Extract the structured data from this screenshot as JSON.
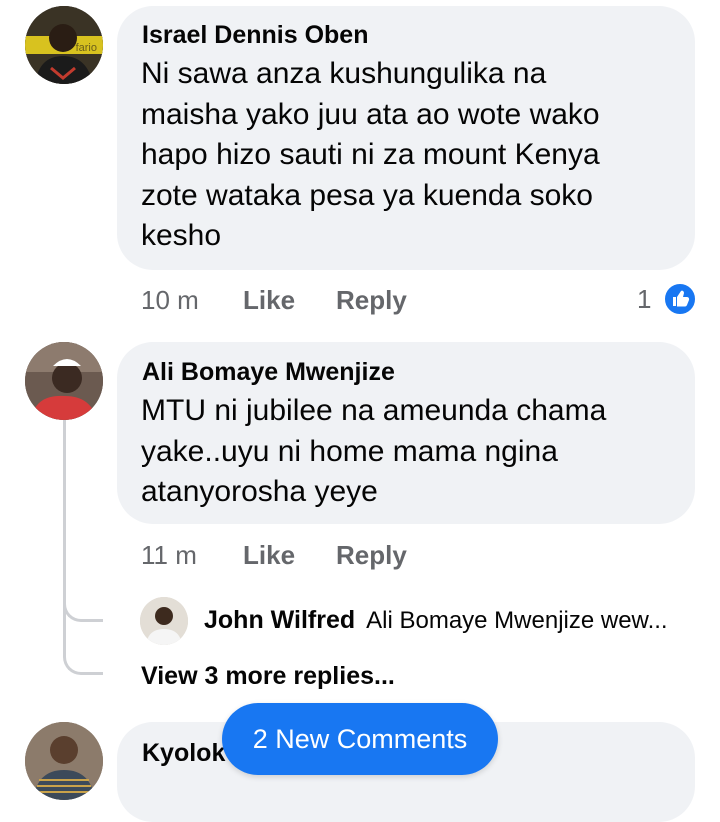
{
  "comments": [
    {
      "author": "Israel Dennis Oben",
      "text_lines": [
        "Ni sawa anza kushungulika na",
        "maisha yako juu ata ao wote wako",
        "hapo hizo sauti ni za mount Kenya",
        "zote wataka pesa ya kuenda soko",
        "kesho"
      ],
      "time": "10 m",
      "like_label": "Like",
      "reply_label": "Reply",
      "reaction_count": "1",
      "avatar_badge": "fario"
    },
    {
      "author": "Ali Bomaye Mwenjize",
      "text_lines": [
        "MTU ni jubilee na ameunda chama",
        "yake..uyu ni home mama ngina",
        "atanyorosha yeye"
      ],
      "time": "11 m",
      "like_label": "Like",
      "reply_label": "Reply",
      "reply_preview": {
        "author": "John Wilfred",
        "text": "Ali Bomaye Mwenjize wew..."
      },
      "view_more": "View 3 more replies..."
    },
    {
      "author": "Kyolok"
    }
  ],
  "new_comments_label": "2 New Comments",
  "colors": {
    "accent": "#1877f2",
    "bubble": "#f0f2f5",
    "meta": "#65676b"
  }
}
